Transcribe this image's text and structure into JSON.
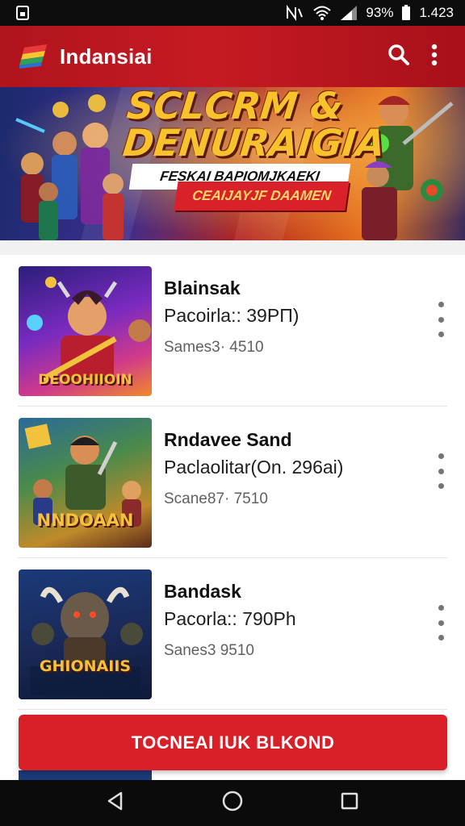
{
  "status_bar": {
    "battery_percent": "93%",
    "time": "1.423",
    "icons": [
      "sim-card-icon",
      "nfc-icon",
      "wifi-icon",
      "signal-icon",
      "battery-icon"
    ]
  },
  "app_bar": {
    "title": "Indansiai",
    "icons": [
      "app-logo-icon",
      "search-icon",
      "more-vert-icon"
    ]
  },
  "banner": {
    "title_line1": "SCLCRM &",
    "title_line2": "DENURAIGIA",
    "subtitle": "FESKAI BAPIOMJKAEKI",
    "ribbon": "CEAIJAYJF DAAMEN"
  },
  "games": [
    {
      "name": "Blainsak",
      "subtitle": "Pacoirla:: 39PП)",
      "meta": "Sames3· 4510",
      "thumb_text": "DEOOHIIOIN"
    },
    {
      "name": "Rndavee Sand",
      "subtitle": "Paclaolitar(On. 296ai)",
      "meta": "Scane87· 7510",
      "thumb_text": "NNDOAAN"
    },
    {
      "name": "Bandask",
      "subtitle": "Pacorla:: 790Ph",
      "meta": "Sanes3 9510",
      "thumb_text": "GHIONAIIS"
    }
  ],
  "cta": {
    "label": "TOCNEAI IUK BLKOND"
  },
  "nav_bar": {
    "icons": [
      "back-icon",
      "home-icon",
      "recents-icon"
    ]
  },
  "colors": {
    "accent": "#d91f27",
    "app_bar": "#c61a22",
    "text_primary": "#111111",
    "text_secondary": "#606060"
  }
}
